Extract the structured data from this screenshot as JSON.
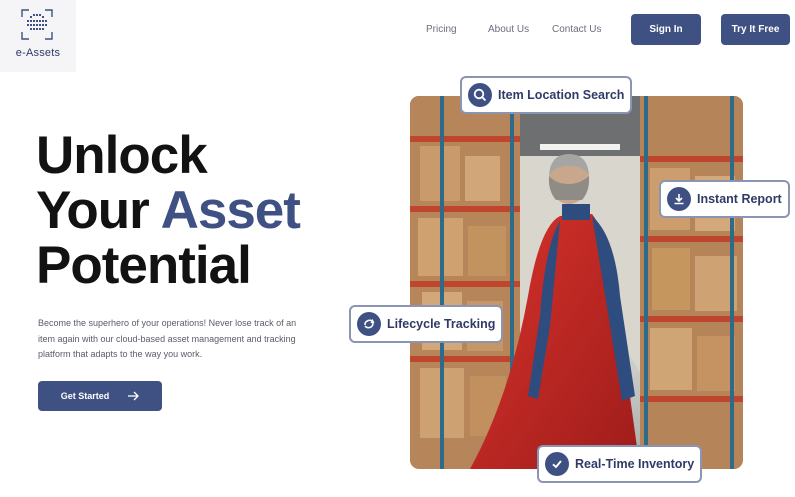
{
  "brand": {
    "logo_text": "e-Assets"
  },
  "nav": {
    "links": [
      "Pricing",
      "About Us",
      "Contact Us"
    ],
    "sign_in": "Sign In",
    "try_free": "Try It Free"
  },
  "hero": {
    "title_line1": "Unlock",
    "title_line2_prefix": "Your",
    "title_line2_accent": "Asset",
    "title_line3": "Potential",
    "description": "Become the superhero of your operations! Never lose track of an item again with our cloud-based asset management and tracking platform that adapts to the way you work.",
    "cta_label": "Get Started"
  },
  "features": {
    "search": "Item Location Search",
    "report": "Instant Report",
    "lifecycle": "Lifecycle Tracking",
    "inventory": "Real-Time Inventory"
  },
  "colors": {
    "accent": "#3f5183",
    "badge_border": "#8a94b3"
  },
  "icons": [
    "search-icon",
    "download-icon",
    "recycle-icon",
    "check-icon",
    "arrow-right-icon"
  ]
}
